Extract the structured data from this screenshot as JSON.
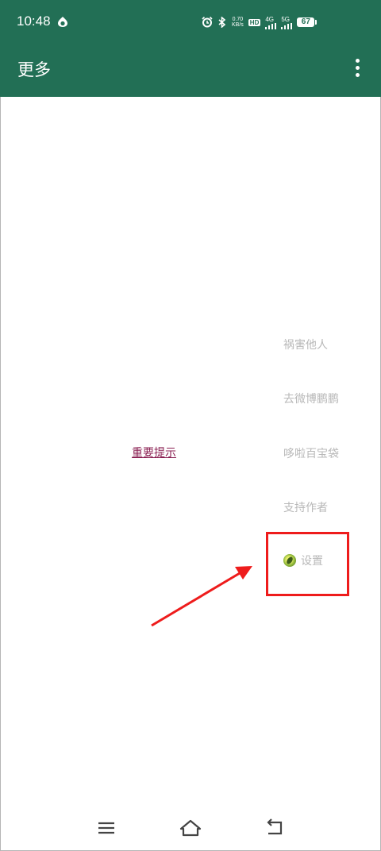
{
  "status_bar": {
    "time": "10:48",
    "speed_value": "0.70",
    "speed_unit": "KB/s",
    "hd_label": "HD",
    "net_4g": "4G",
    "net_5g": "5G",
    "battery": "67"
  },
  "app_bar": {
    "title": "更多",
    "overflow_icon": "more-vert-icon"
  },
  "main": {
    "notice_link": "重要提示",
    "menu_items": [
      "祸害他人",
      "去微博鹏鹏",
      "哆啦百宝袋",
      "支持作者"
    ],
    "settings": {
      "label": "设置",
      "icon": "kiwi-icon"
    }
  },
  "annotation": {
    "color": "#ee1c1c"
  },
  "nav_bar": {
    "icons": [
      "menu-icon",
      "home-icon",
      "back-icon"
    ]
  },
  "colors": {
    "primary": "#226f55",
    "link": "#8a1f52",
    "muted_text": "#b8b8b8"
  }
}
